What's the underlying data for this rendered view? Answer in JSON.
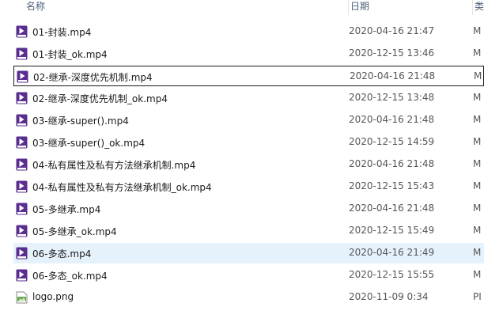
{
  "columns": {
    "name": "名称",
    "date": "日期",
    "type": "类"
  },
  "files": [
    {
      "name": "01-封装.mp4",
      "date": "2020-04-16 21:47",
      "type": "M",
      "icon": "video-file-icon"
    },
    {
      "name": "01-封装_ok.mp4",
      "date": "2020-12-15 13:46",
      "type": "M",
      "icon": "video-file-icon"
    },
    {
      "name": "02-继承-深度优先机制.mp4",
      "date": "2020-04-16 21:48",
      "type": "M",
      "icon": "video-file-icon",
      "focused": true
    },
    {
      "name": "02-继承-深度优先机制_ok.mp4",
      "date": "2020-12-15 13:48",
      "type": "M",
      "icon": "video-file-icon"
    },
    {
      "name": "03-继承-super().mp4",
      "date": "2020-04-16 21:48",
      "type": "M",
      "icon": "video-file-icon"
    },
    {
      "name": "03-继承-super()_ok.mp4",
      "date": "2020-12-15 14:59",
      "type": "M",
      "icon": "video-file-icon"
    },
    {
      "name": "04-私有属性及私有方法继承机制.mp4",
      "date": "2020-04-16 21:48",
      "type": "M",
      "icon": "video-file-icon"
    },
    {
      "name": "04-私有属性及私有方法继承机制_ok.mp4",
      "date": "2020-12-15 15:43",
      "type": "M",
      "icon": "video-file-icon"
    },
    {
      "name": "05-多继承.mp4",
      "date": "2020-04-16 21:48",
      "type": "M",
      "icon": "video-file-icon"
    },
    {
      "name": "05-多继承_ok.mp4",
      "date": "2020-12-15 15:49",
      "type": "M",
      "icon": "video-file-icon"
    },
    {
      "name": "06-多态.mp4",
      "date": "2020-04-16 21:49",
      "type": "M",
      "icon": "video-file-icon",
      "selected": true
    },
    {
      "name": "06-多态_ok.mp4",
      "date": "2020-12-15 15:55",
      "type": "M",
      "icon": "video-file-icon"
    },
    {
      "name": "logo.png",
      "date": "2020-11-09 0:34",
      "type": "PI",
      "icon": "image-file-icon"
    }
  ],
  "colors": {
    "selected_row": "#e6f2fb",
    "video_icon": "#5a2d91",
    "image_icon": "#6aa84f"
  }
}
